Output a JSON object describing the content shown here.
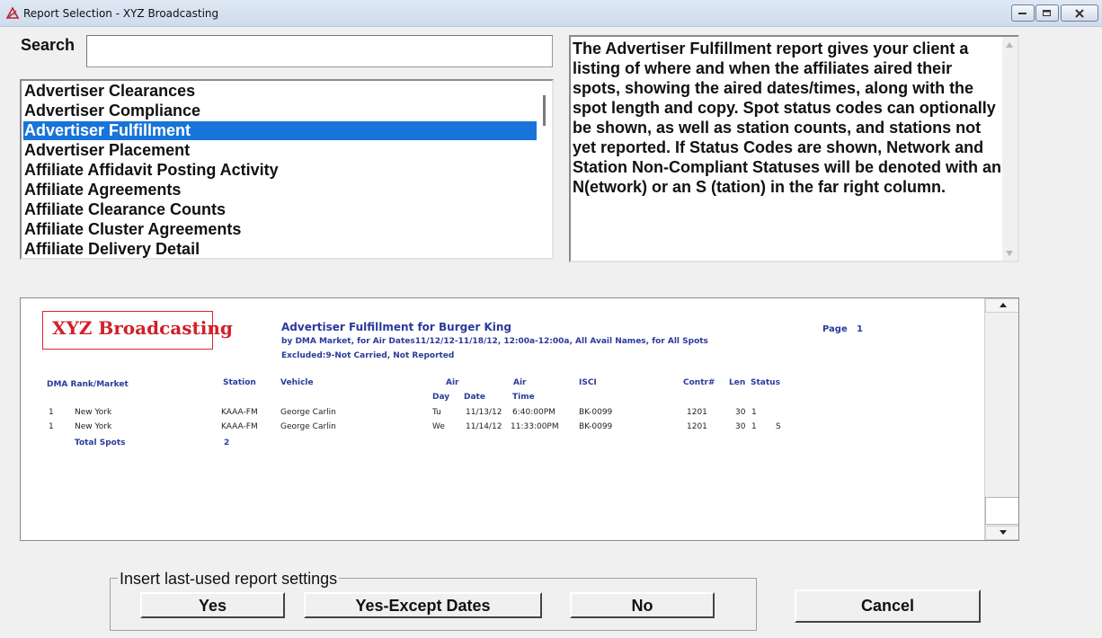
{
  "window": {
    "title": "Report Selection - XYZ Broadcasting"
  },
  "search": {
    "label": "Search",
    "value": ""
  },
  "report_list": {
    "items": [
      "Advertiser Clearances",
      "Advertiser Compliance",
      "Advertiser Fulfillment",
      "Advertiser Placement",
      "Affiliate Affidavit Posting Activity",
      "Affiliate Agreements",
      "Affiliate Clearance Counts",
      "Affiliate Cluster Agreements",
      "Affiliate Delivery Detail"
    ],
    "selected": "Advertiser Fulfillment"
  },
  "description": {
    "text": "The Advertiser Fulfillment report gives your client a listing of where and when the affiliates aired their spots, showing the aired dates/times, along with the spot length and copy. Spot status codes can optionally be shown, as well as station counts, and stations not yet reported. If Status Codes are shown, Network and Station Non-Compliant Statuses will be denoted with an N(etwork) or an S (tation) in the far right column."
  },
  "preview": {
    "logo": "XYZ Broadcasting",
    "heading": "Advertiser Fulfillment for Burger King",
    "subheading": "by DMA Market, for Air Dates11/12/12-11/18/12, 12:00a-12:00a, All Avail Names, for All Spots",
    "excluded": "Excluded:9-Not Carried, Not Reported",
    "page_label": "Page",
    "page_number": "1",
    "columns": {
      "dma": "DMA Rank/Market",
      "station": "Station",
      "vehicle": "Vehicle",
      "air1": "Air",
      "air2": "Air",
      "day": "Day",
      "date": "Date",
      "time": "Time",
      "isci": "ISCI",
      "contr": "Contr#",
      "len": "Len",
      "status": "Status"
    },
    "rows": [
      {
        "rank": "1",
        "market": "New York",
        "station": "KAAA-FM",
        "vehicle": "George Carlin",
        "day": "Tu",
        "date": "11/13/12",
        "time": "6:40:00PM",
        "isci": "BK-0099",
        "contr": "1201",
        "len": "30",
        "status": "1",
        "flag": ""
      },
      {
        "rank": "1",
        "market": "New York",
        "station": "KAAA-FM",
        "vehicle": "George Carlin",
        "day": "We",
        "date": "11/14/12",
        "time": "11:33:00PM",
        "isci": "BK-0099",
        "contr": "1201",
        "len": "30",
        "status": "1",
        "flag": "S"
      }
    ],
    "total_label": "Total Spots",
    "total_value": "2"
  },
  "settings": {
    "legend": "Insert last-used report settings",
    "yes": "Yes",
    "yes_except": "Yes-Except Dates",
    "no": "No"
  },
  "cancel_label": "Cancel",
  "colors": {
    "selection": "#1874d8",
    "report_blue": "#2a3a9b",
    "logo_red": "#d1202a"
  }
}
